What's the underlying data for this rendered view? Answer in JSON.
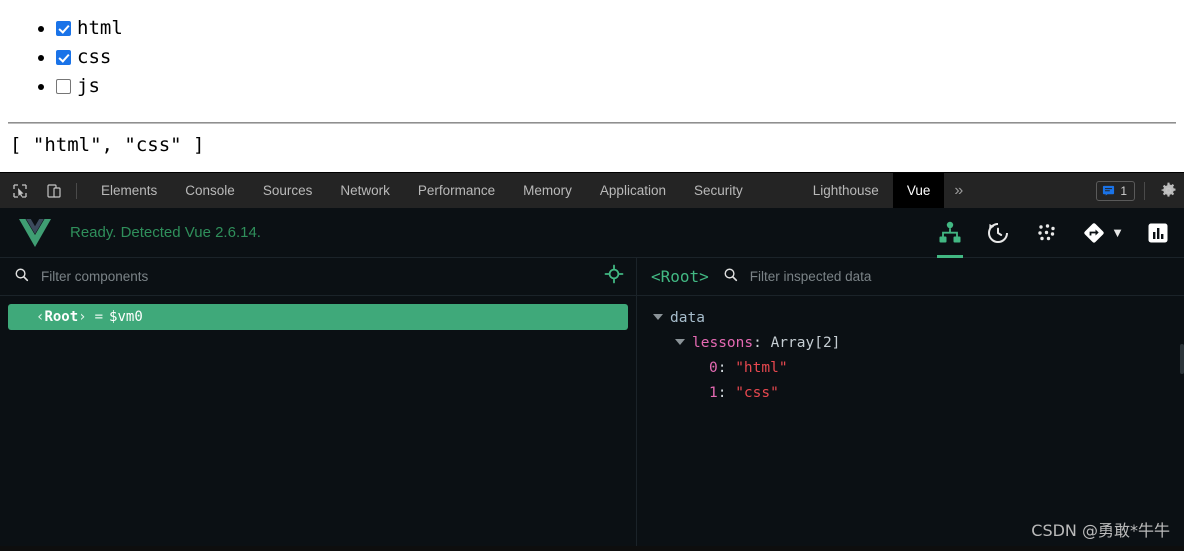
{
  "page": {
    "checkbox_items": [
      {
        "label": "html",
        "checked": true
      },
      {
        "label": "css",
        "checked": true
      },
      {
        "label": "js",
        "checked": false
      }
    ],
    "array_output": "[ \"html\", \"css\" ]"
  },
  "devtools": {
    "toolbar_icons": [
      {
        "name": "inspect-element-icon"
      },
      {
        "name": "device-toolbar-icon"
      }
    ],
    "tabs": [
      {
        "label": "Elements",
        "active": false
      },
      {
        "label": "Console",
        "active": false
      },
      {
        "label": "Sources",
        "active": false
      },
      {
        "label": "Network",
        "active": false
      },
      {
        "label": "Performance",
        "active": false
      },
      {
        "label": "Memory",
        "active": false
      },
      {
        "label": "Application",
        "active": false
      },
      {
        "label": "Security",
        "active": false
      },
      {
        "label": "Lighthouse",
        "active": false
      },
      {
        "label": "Vue",
        "active": true
      }
    ],
    "overflow_label": "»",
    "message_badge_count": "1",
    "settings_icon": "gear-icon"
  },
  "vue": {
    "status_text": "Ready. Detected Vue 2.6.14.",
    "logo_name": "vue-logo",
    "header_tools": [
      {
        "name": "components-tab-icon",
        "active": true
      },
      {
        "name": "timeline-history-icon",
        "active": false
      },
      {
        "name": "vuex-dots-icon",
        "active": false
      },
      {
        "name": "routing-diamond-icon",
        "active": false
      },
      {
        "name": "performance-chart-icon",
        "active": false
      }
    ],
    "components": {
      "filter_placeholder": "Filter components",
      "filter_value": "",
      "select_icon": "target-crosshair-icon",
      "tree": [
        {
          "open_angle": "‹",
          "name": "Root",
          "close_angle": "›",
          "eq": "=",
          "instance": "$vm0",
          "selected": true
        }
      ]
    },
    "inspector": {
      "component_title": "<Root>",
      "filter_placeholder": "Filter inspected data",
      "filter_value": "",
      "tree": {
        "section": "data",
        "prop_name": "lessons",
        "colon": ":",
        "prop_type": "Array[2]",
        "items": [
          {
            "index": "0",
            "colon": ":",
            "value": "\"html\""
          },
          {
            "index": "1",
            "colon": ":",
            "value": "\"css\""
          }
        ]
      }
    }
  },
  "watermark": {
    "text": "CSDN @勇敢*牛牛"
  },
  "colors": {
    "vue_green": "#42b883",
    "selection_green": "#3fa97a",
    "string_red": "#e8484f",
    "key_pink": "#e56ab3",
    "checkbox_blue": "#1a73e8",
    "panel_bg": "#0b1014",
    "tabbar_bg": "#242424"
  }
}
